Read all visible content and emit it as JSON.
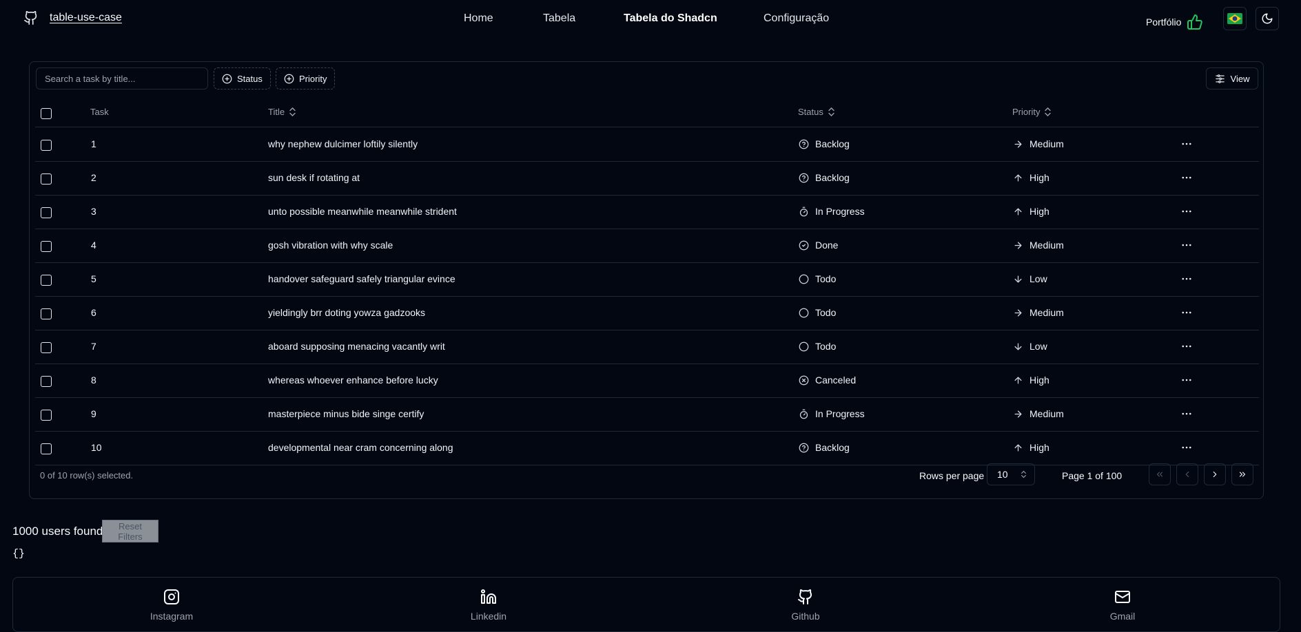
{
  "header": {
    "repo_name": "table-use-case",
    "nav": [
      "Home",
      "Tabela",
      "Tabela do Shadcn",
      "Configuração"
    ],
    "active_nav": "Tabela do Shadcn",
    "portfolio_label": "Portfólio",
    "icons": [
      "github-icon",
      "thumbs-up-icon",
      "brazil-flag-icon",
      "moon-icon"
    ]
  },
  "toolbar": {
    "search_placeholder": "Search a task by title...",
    "status_filter": "Status",
    "priority_filter": "Priority",
    "view_label": "View"
  },
  "table": {
    "columns": [
      "Task",
      "Title",
      "Status",
      "Priority"
    ],
    "rows": [
      {
        "task": "1",
        "title": "why nephew dulcimer loftily silently",
        "status": "Backlog",
        "priority": "Medium"
      },
      {
        "task": "2",
        "title": "sun desk if rotating at",
        "status": "Backlog",
        "priority": "High"
      },
      {
        "task": "3",
        "title": "unto possible meanwhile meanwhile strident",
        "status": "In Progress",
        "priority": "High"
      },
      {
        "task": "4",
        "title": "gosh vibration with why scale",
        "status": "Done",
        "priority": "Medium"
      },
      {
        "task": "5",
        "title": "handover safeguard safely triangular evince",
        "status": "Todo",
        "priority": "Low"
      },
      {
        "task": "6",
        "title": "yieldingly brr doting yowza gadzooks",
        "status": "Todo",
        "priority": "Medium"
      },
      {
        "task": "7",
        "title": "aboard supposing menacing vacantly writ",
        "status": "Todo",
        "priority": "Low"
      },
      {
        "task": "8",
        "title": "whereas whoever enhance before lucky",
        "status": "Canceled",
        "priority": "High"
      },
      {
        "task": "9",
        "title": "masterpiece minus bide singe certify",
        "status": "In Progress",
        "priority": "Medium"
      },
      {
        "task": "10",
        "title": "developmental near cram concerning along",
        "status": "Backlog",
        "priority": "High"
      }
    ]
  },
  "pagination": {
    "selected_text": "0 of 10 row(s) selected.",
    "rows_per_page_label": "Rows per page",
    "rows_per_page_value": "10",
    "page_text": "Page 1 of 100"
  },
  "summary": {
    "found_text": "1000 users found",
    "reset_label": "Reset Filters",
    "json_text": "{}"
  },
  "social": [
    "Instagram",
    "Linkedin",
    "Github",
    "Gmail"
  ]
}
